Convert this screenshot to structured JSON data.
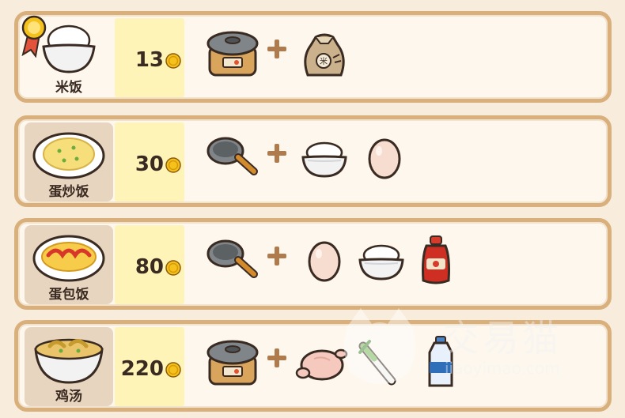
{
  "recipes": [
    {
      "name": "米饭",
      "price": "13",
      "locked": false,
      "has_medal": true,
      "dish_icon": "rice-bowl-icon",
      "ingredients": [
        "rice-cooker-icon",
        "rice-sack-icon"
      ]
    },
    {
      "name": "蛋炒饭",
      "price": "30",
      "locked": true,
      "has_medal": false,
      "dish_icon": "fried-rice-icon",
      "ingredients": [
        "frying-pan-icon",
        "rice-bowl-icon",
        "egg-icon"
      ]
    },
    {
      "name": "蛋包饭",
      "price": "80",
      "locked": true,
      "has_medal": false,
      "dish_icon": "omurice-icon",
      "ingredients": [
        "frying-pan-icon",
        "egg-icon",
        "rice-bowl-icon",
        "ketchup-icon"
      ]
    },
    {
      "name": "鸡汤",
      "price": "220",
      "locked": true,
      "has_medal": false,
      "dish_icon": "chicken-soup-icon",
      "ingredients": [
        "rice-cooker-icon",
        "raw-chicken-icon",
        "leek-icon",
        "water-bottle-icon"
      ]
    }
  ],
  "watermark": {
    "text": "交易猫",
    "url": "jiaoyimao.com"
  },
  "colors": {
    "border": "#d9b07c",
    "price_bg": "#fff4b8",
    "locked_bg": "#e8d5c0",
    "coin": "#f5c21b"
  }
}
